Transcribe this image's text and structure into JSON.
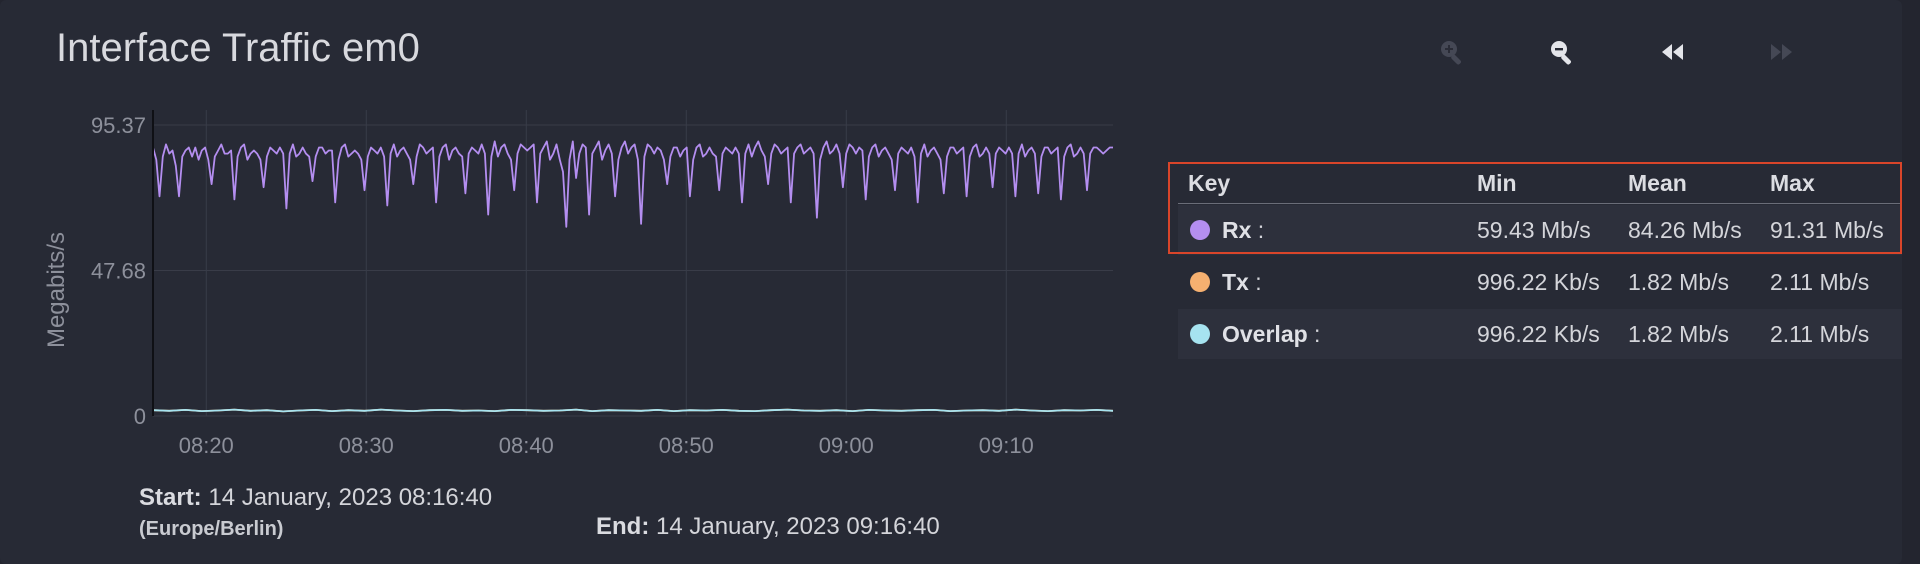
{
  "window": {
    "title": "Interface Traffic em0"
  },
  "toolbar": {
    "zoom_in_icon": "zoom-in-icon",
    "zoom_out_icon": "zoom-out-icon",
    "back_icon": "rewind-icon",
    "forward_icon": "fast-forward-icon"
  },
  "chart_data": {
    "type": "line",
    "ylabel": "Megabits/s",
    "xlabel": "",
    "yticks": [
      "95.37",
      "47.68",
      "0"
    ],
    "ylim": [
      0,
      95.37
    ],
    "xticks": [
      "08:20",
      "08:30",
      "08:40",
      "08:50",
      "09:00",
      "09:10"
    ],
    "xrange_minutes": [
      16.67,
      76.67
    ],
    "grid": true,
    "legend": "right",
    "series": [
      {
        "name": "Rx",
        "color": "#b48ef0",
        "sample_step_seconds": 12,
        "values": [
          88.0,
          84.0,
          72.0,
          85.0,
          89.0,
          86.0,
          87.0,
          82.0,
          72.0,
          85.0,
          87.0,
          88.0,
          85.0,
          88.0,
          84.0,
          87.0,
          88.0,
          84.0,
          76.0,
          85.0,
          87.0,
          89.0,
          86.0,
          86.0,
          87.0,
          71.0,
          85.0,
          88.0,
          89.0,
          84.0,
          86.0,
          87.0,
          86.0,
          84.0,
          75.0,
          85.0,
          88.0,
          87.0,
          86.0,
          88.0,
          86.0,
          68.0,
          86.0,
          89.0,
          85.0,
          86.0,
          88.0,
          86.0,
          85.0,
          77.0,
          85.0,
          88.0,
          88.0,
          86.0,
          87.0,
          87.0,
          70.0,
          84.0,
          88.0,
          89.0,
          85.0,
          86.0,
          87.0,
          86.0,
          84.0,
          74.0,
          85.0,
          88.0,
          87.0,
          86.0,
          88.0,
          85.0,
          69.0,
          86.0,
          89.0,
          85.0,
          87.0,
          88.0,
          86.0,
          84.0,
          76.0,
          85.0,
          89.0,
          88.0,
          86.0,
          87.0,
          88.0,
          70.0,
          85.0,
          88.0,
          89.0,
          84.0,
          87.0,
          88.0,
          86.0,
          85.0,
          73.0,
          86.0,
          88.0,
          87.0,
          86.0,
          89.0,
          86.0,
          66.0,
          85.0,
          90.0,
          85.0,
          88.0,
          89.0,
          86.0,
          84.0,
          74.0,
          86.0,
          89.0,
          88.0,
          87.0,
          88.0,
          89.0,
          70.0,
          86.0,
          88.0,
          90.0,
          84.0,
          86.0,
          89.0,
          84.0,
          80.0,
          62.0,
          84.0,
          90.0,
          78.0,
          86.0,
          89.0,
          88.0,
          66.0,
          86.0,
          88.0,
          90.0,
          84.0,
          87.0,
          89.0,
          86.0,
          72.0,
          84.0,
          88.0,
          90.0,
          86.0,
          88.0,
          89.0,
          84.0,
          63.0,
          85.0,
          89.0,
          88.0,
          86.0,
          88.0,
          87.0,
          84.0,
          76.0,
          85.0,
          88.0,
          88.0,
          85.0,
          87.0,
          88.0,
          72.0,
          84.0,
          88.0,
          89.0,
          85.0,
          86.0,
          88.0,
          86.0,
          85.0,
          74.0,
          86.0,
          88.0,
          87.0,
          86.0,
          88.0,
          86.0,
          70.0,
          86.0,
          89.0,
          85.0,
          88.0,
          90.0,
          87.0,
          85.0,
          76.0,
          86.0,
          89.0,
          88.0,
          86.0,
          87.0,
          88.0,
          70.0,
          86.0,
          88.0,
          89.0,
          86.0,
          87.0,
          88.0,
          86.0,
          65.0,
          84.0,
          88.0,
          90.0,
          86.0,
          87.0,
          89.0,
          86.0,
          75.0,
          86.0,
          89.0,
          88.0,
          86.0,
          88.0,
          87.0,
          71.0,
          85.0,
          88.0,
          89.0,
          85.0,
          87.0,
          88.0,
          86.0,
          84.0,
          74.0,
          86.0,
          88.0,
          87.0,
          86.0,
          88.0,
          85.0,
          70.0,
          86.0,
          89.0,
          85.0,
          87.0,
          88.0,
          86.0,
          84.0,
          73.0,
          85.0,
          88.0,
          88.0,
          86.0,
          87.0,
          88.0,
          72.0,
          85.0,
          88.0,
          89.0,
          85.0,
          86.0,
          88.0,
          86.0,
          75.0,
          86.0,
          88.0,
          87.0,
          86.0,
          88.0,
          86.0,
          72.0,
          86.0,
          89.0,
          85.0,
          87.0,
          88.0,
          86.0,
          73.0,
          85.0,
          88.0,
          88.0,
          86.0,
          87.0,
          88.0,
          71.0,
          85.0,
          88.0,
          89.0,
          85.0,
          86.0,
          88.0,
          86.0,
          74.0,
          86.0,
          88.0,
          88.0,
          87.0,
          86.0,
          87.0,
          88.0,
          88.0
        ]
      },
      {
        "name": "Tx",
        "color": "#f5b070",
        "sample_step_seconds": 12,
        "values": [
          1.9,
          1.7,
          2.0,
          1.6,
          1.8,
          2.1,
          1.7,
          1.9,
          1.5,
          1.8,
          2.0,
          1.6,
          1.9,
          1.7,
          2.1,
          1.8,
          1.6,
          1.9,
          2.0,
          1.7,
          1.8,
          1.6,
          2.0,
          1.9,
          1.7,
          1.8,
          2.1,
          1.6,
          1.9,
          1.8,
          1.7,
          2.0,
          1.6,
          1.9,
          1.8,
          2.0,
          1.7,
          1.6,
          1.9,
          2.1,
          1.8,
          1.7,
          1.9,
          1.6,
          2.0,
          1.8,
          1.7,
          1.9,
          2.0,
          1.6,
          1.8,
          1.9,
          1.7,
          2.1,
          1.8,
          1.6,
          1.9,
          1.8,
          2.0,
          1.7
        ]
      },
      {
        "name": "Overlap",
        "color": "#a6e3f0",
        "sample_step_seconds": 12,
        "values": [
          1.9,
          1.7,
          2.0,
          1.6,
          1.8,
          2.1,
          1.7,
          1.9,
          1.5,
          1.8,
          2.0,
          1.6,
          1.9,
          1.7,
          2.1,
          1.8,
          1.6,
          1.9,
          2.0,
          1.7,
          1.8,
          1.6,
          2.0,
          1.9,
          1.7,
          1.8,
          2.1,
          1.6,
          1.9,
          1.8,
          1.7,
          2.0,
          1.6,
          1.9,
          1.8,
          2.0,
          1.7,
          1.6,
          1.9,
          2.1,
          1.8,
          1.7,
          1.9,
          1.6,
          2.0,
          1.8,
          1.7,
          1.9,
          2.0,
          1.6,
          1.8,
          1.9,
          1.7,
          2.1,
          1.8,
          1.6,
          1.9,
          1.8,
          2.0,
          1.7
        ]
      }
    ]
  },
  "footer": {
    "start_label": "Start:",
    "start_value": "14 January, 2023 08:16:40",
    "start_tz": "(Europe/Berlin)",
    "end_label": "End:",
    "end_value": "14 January, 2023 09:16:40"
  },
  "legend": {
    "headers": [
      "Key",
      "Min",
      "Mean",
      "Max"
    ],
    "rows": [
      {
        "name": "Rx",
        "sep": ":",
        "min": "59.43 Mb/s",
        "mean": "84.26 Mb/s",
        "max": "91.31 Mb/s",
        "color": "#b48ef0"
      },
      {
        "name": "Tx",
        "sep": ":",
        "min": "996.22 Kb/s",
        "mean": "1.82 Mb/s",
        "max": "2.11 Mb/s",
        "color": "#f5b070"
      },
      {
        "name": "Overlap",
        "sep": ":",
        "min": "996.22 Kb/s",
        "mean": "1.82 Mb/s",
        "max": "2.11 Mb/s",
        "color": "#a6e3f0"
      }
    ]
  },
  "highlight": {
    "color": "#d9452a"
  }
}
